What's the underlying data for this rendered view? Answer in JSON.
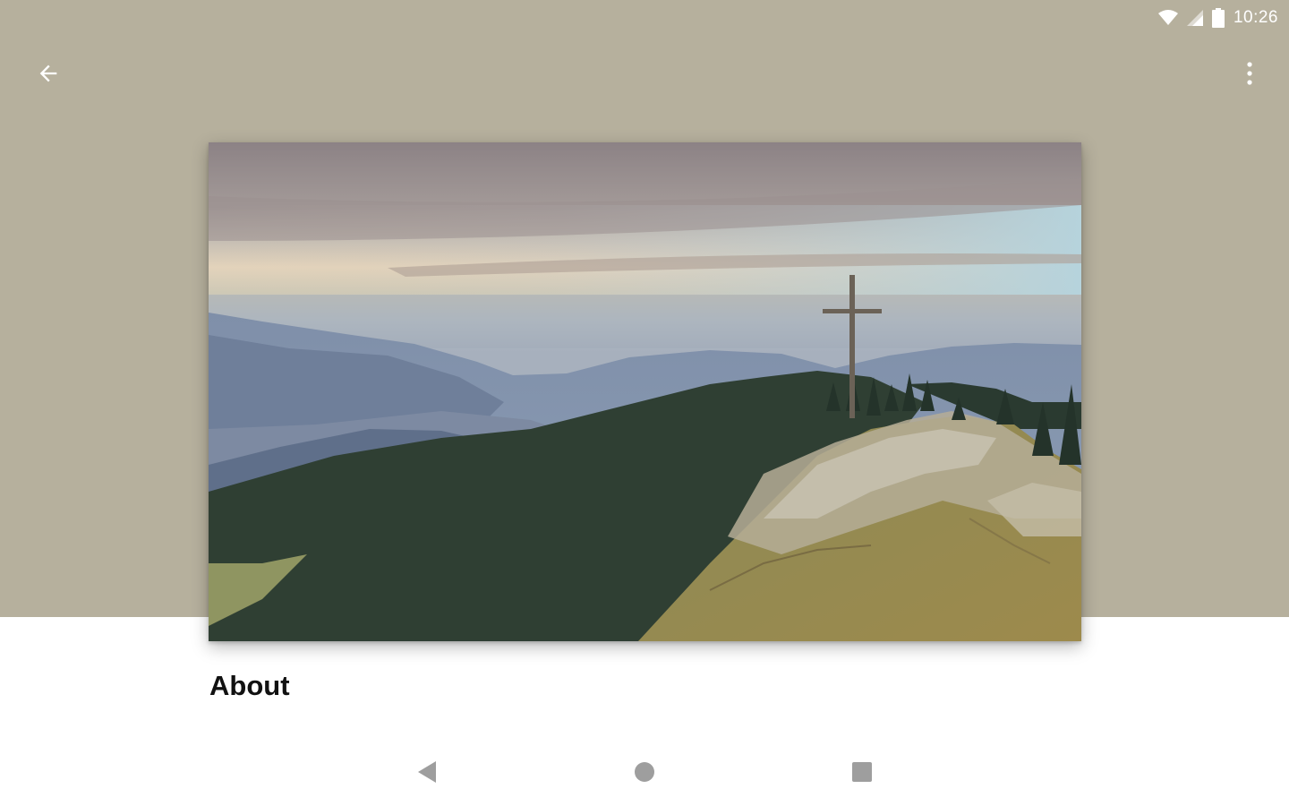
{
  "status_bar": {
    "time": "10:26",
    "wifi_icon": "wifi-icon",
    "signal_icon": "cell-signal-icon",
    "battery_icon": "battery-icon"
  },
  "app_bar": {
    "back_icon": "arrow-back-icon",
    "overflow_icon": "more-vert-icon"
  },
  "hero_image": {
    "description_icon": "landscape-photo"
  },
  "content": {
    "section_title": "About"
  },
  "nav_bar": {
    "back_icon": "nav-back-triangle-icon",
    "home_icon": "nav-home-circle-icon",
    "recents_icon": "nav-recents-square-icon"
  },
  "colors": {
    "header_bg": "#b6b09d",
    "page_bg": "#ffffff",
    "title_text": "#111111",
    "nav_icons": "#9e9e9e"
  }
}
